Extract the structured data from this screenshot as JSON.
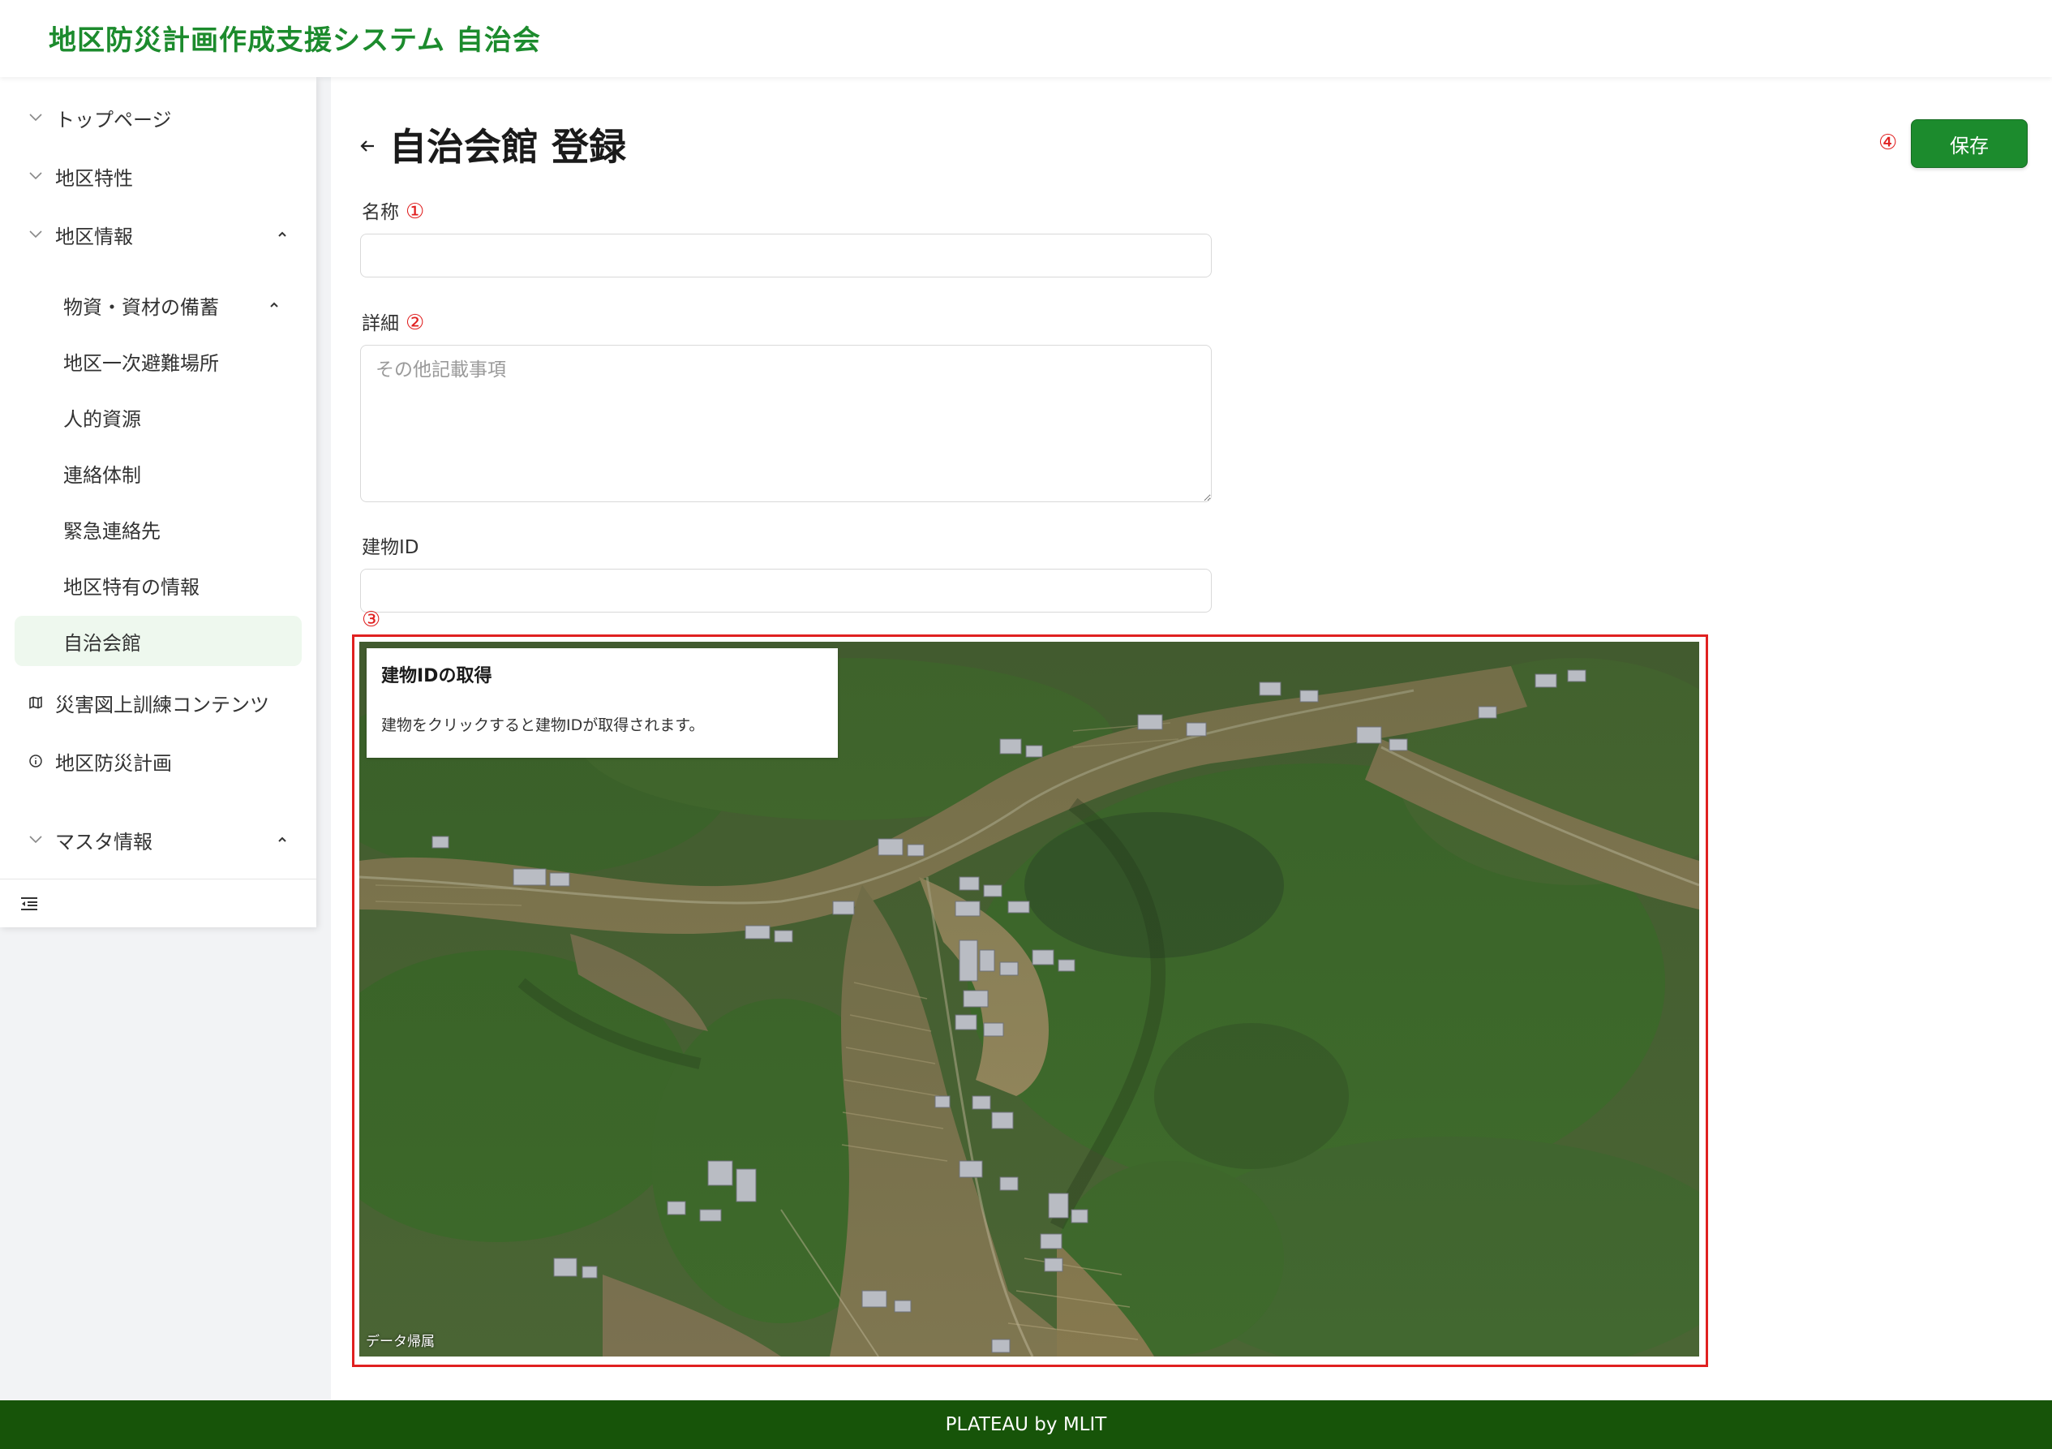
{
  "header": {
    "title": "地区防災計画作成支援システム 自治会"
  },
  "sidebar": {
    "items": [
      {
        "label": "トップページ",
        "icon": "chevron-down-icon"
      },
      {
        "label": "地区特性",
        "icon": "chevron-down-icon"
      },
      {
        "label": "地区情報",
        "icon": "chevron-down-icon",
        "expanded": true
      },
      {
        "label": "災害図上訓練コンテンツ",
        "icon": "map-icon"
      },
      {
        "label": "地区防災計画",
        "icon": "info-circle-icon"
      },
      {
        "label": "マスタ情報",
        "icon": "chevron-down-icon",
        "expanded": true
      }
    ],
    "sub_items": [
      {
        "label": "物資・資材の備蓄",
        "expanded": true
      },
      {
        "label": "地区一次避難場所"
      },
      {
        "label": "人的資源"
      },
      {
        "label": "連絡体制"
      },
      {
        "label": "緊急連絡先"
      },
      {
        "label": "地区特有の情報"
      },
      {
        "label": "自治会館",
        "selected": true
      }
    ],
    "collapse_icon": "menu-fold-icon"
  },
  "page": {
    "title": "自治会館 登録",
    "save_label": "保存",
    "save_number": "④"
  },
  "form": {
    "name": {
      "label": "名称",
      "number": "①",
      "value": "",
      "placeholder": ""
    },
    "detail": {
      "label": "詳細",
      "number": "②",
      "value": "",
      "placeholder": "その他記載事項"
    },
    "building_id": {
      "label": "建物ID",
      "value": "",
      "placeholder": ""
    }
  },
  "map": {
    "number": "③",
    "card_title": "建物IDの取得",
    "card_desc": "建物をクリックすると建物IDが取得されます。",
    "attribution": "データ帰属"
  },
  "footer": {
    "text": "PLATEAU by MLIT"
  },
  "colors": {
    "brand_green": "#1c8b2d",
    "footer_green": "#175409",
    "annotation_red": "#e02020",
    "selected_bg": "#eef8ee"
  }
}
